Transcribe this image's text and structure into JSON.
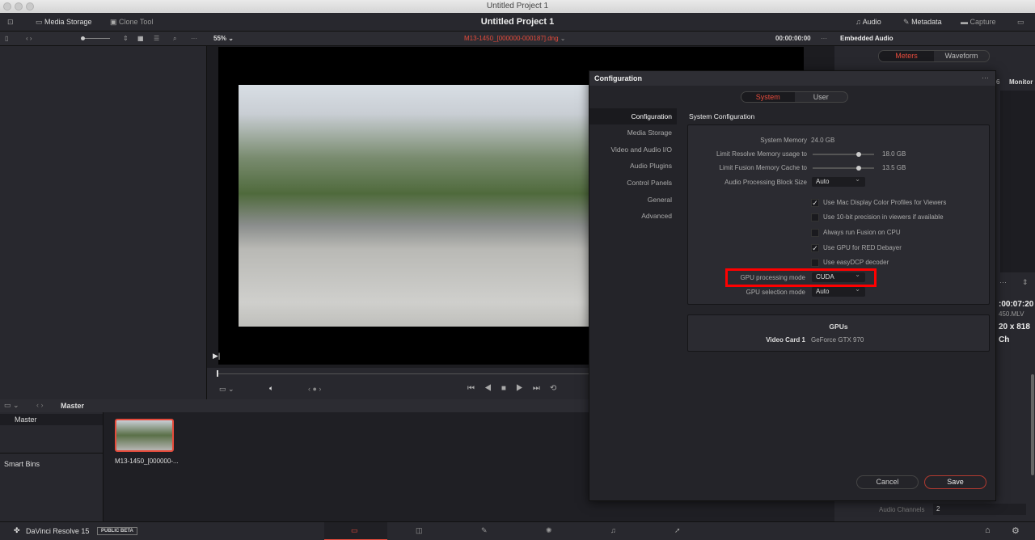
{
  "window": {
    "title": "Untitled Project 1"
  },
  "toolbar": {
    "media_storage": "Media Storage",
    "clone_tool": "Clone Tool",
    "project_title": "Untitled Project 1",
    "audio": "Audio",
    "metadata": "Metadata",
    "capture": "Capture"
  },
  "viewer": {
    "zoom": "55%",
    "clip_name": "M13-1450_[000000-000187].dng",
    "timecode": "00:00:00:00"
  },
  "right_panel": {
    "title": "Embedded Audio",
    "tabs": [
      "Meters",
      "Waveform"
    ],
    "monitor": "Monitor",
    "channel_num": "6",
    "duration": ":00:07:20",
    "filename": "450.MLV",
    "resolution": "20 x 818",
    "channels_short": "Ch",
    "audio_channels_label": "Audio Channels",
    "audio_channels_value": "2"
  },
  "media_pool": {
    "header": "Master",
    "bins": {
      "master": "Master",
      "smart_bins": "Smart Bins"
    },
    "clip_name": "M13-1450_[000000-..."
  },
  "footer": {
    "app_name": "DaVinci Resolve 15",
    "badge": "PUBLIC BETA"
  },
  "dialog": {
    "title": "Configuration",
    "tabs": [
      "System",
      "User"
    ],
    "nav": [
      "Configuration",
      "Media Storage",
      "Video and Audio I/O",
      "Audio Plugins",
      "Control Panels",
      "General",
      "Advanced"
    ],
    "section_title": "System Configuration",
    "system_memory_label": "System Memory",
    "system_memory_value": "24.0 GB",
    "limit_resolve_label": "Limit Resolve Memory usage to",
    "limit_resolve_value": "18.0 GB",
    "limit_resolve_fraction": 0.75,
    "limit_fusion_label": "Limit Fusion Memory Cache to",
    "limit_fusion_value": "13.5 GB",
    "limit_fusion_fraction": 0.75,
    "audio_block_label": "Audio Processing Block Size",
    "audio_block_value": "Auto",
    "checkboxes": [
      {
        "label": "Use Mac Display Color Profiles for Viewers",
        "checked": true
      },
      {
        "label": "Use 10-bit precision in viewers if available",
        "checked": false
      },
      {
        "label": "Always run Fusion on CPU",
        "checked": false
      },
      {
        "label": "Use GPU for RED Debayer",
        "checked": true
      },
      {
        "label": "Use easyDCP decoder",
        "checked": false
      }
    ],
    "gpu_mode_label": "GPU processing mode",
    "gpu_mode_value": "CUDA",
    "gpu_selection_label": "GPU selection mode",
    "gpu_selection_value": "Auto",
    "gpus_title": "GPUs",
    "video_card_label": "Video Card 1",
    "video_card_value": "GeForce GTX 970",
    "cancel": "Cancel",
    "save": "Save"
  },
  "colors": {
    "accent": "#e64b3c",
    "highlight_box": "#ff0000"
  }
}
